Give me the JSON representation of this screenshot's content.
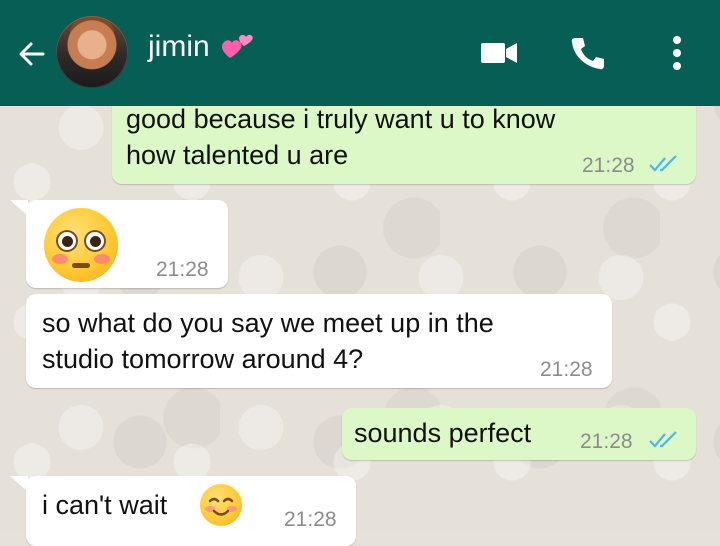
{
  "header": {
    "contact_name": "jimin",
    "back_icon": "arrow-left-icon",
    "heart_emoji": "two-hearts-icon",
    "actions": [
      "video-call-icon",
      "phone-icon",
      "more-vert-icon"
    ],
    "background_color": "#075e54"
  },
  "messages": [
    {
      "direction": "out",
      "lines": [
        "good because i truly want u to know",
        "how talented u are"
      ],
      "time": "21:28",
      "status": "read"
    },
    {
      "direction": "in",
      "emoji": "flushed-face-icon",
      "time": "21:28"
    },
    {
      "direction": "in",
      "lines": [
        "so what do you say we meet up in the",
        "studio tomorrow around 4?"
      ],
      "time": "21:28"
    },
    {
      "direction": "out",
      "lines": [
        "sounds perfect"
      ],
      "time": "21:28",
      "status": "read"
    },
    {
      "direction": "in",
      "lines": [
        "i can't wait"
      ],
      "emoji": "smiling-face-icon",
      "time": "21:28"
    }
  ],
  "colors": {
    "outgoing": "#dcf8c6",
    "incoming": "#ffffff",
    "read_ticks": "#4fb6ec"
  }
}
